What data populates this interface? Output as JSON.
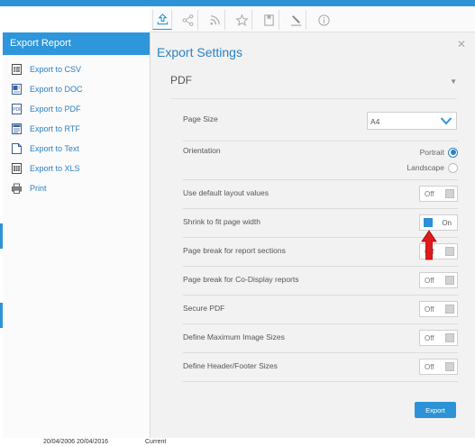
{
  "toolbar": {
    "icons": [
      "export-icon",
      "share-icon",
      "rss-icon",
      "star-icon",
      "bookmark-icon",
      "brush-icon",
      "info-icon"
    ]
  },
  "menu": {
    "title": "Export Report",
    "items": [
      {
        "label": "Export to CSV",
        "icon": "csv-file-icon"
      },
      {
        "label": "Export to DOC",
        "icon": "doc-file-icon"
      },
      {
        "label": "Export to PDF",
        "icon": "pdf-file-icon"
      },
      {
        "label": "Export to RTF",
        "icon": "rtf-file-icon"
      },
      {
        "label": "Export to Text",
        "icon": "text-file-icon"
      },
      {
        "label": "Export to XLS",
        "icon": "xls-file-icon"
      },
      {
        "label": "Print",
        "icon": "printer-icon"
      }
    ]
  },
  "panel": {
    "title": "Export Settings",
    "format": "PDF",
    "page_size": {
      "label": "Page Size",
      "value": "A4"
    },
    "orientation": {
      "label": "Orientation",
      "options": [
        "Portrait",
        "Landscape"
      ],
      "selected": "Portrait"
    },
    "toggles": [
      {
        "label": "Use default layout values",
        "value": "Off"
      },
      {
        "label": "Shrink to fit page width",
        "value": "On"
      },
      {
        "label": "Page break for report sections",
        "value": "Off"
      },
      {
        "label": "Page break for Co-Display reports",
        "value": "Off"
      },
      {
        "label": "Secure PDF",
        "value": "Off"
      },
      {
        "label": "Define Maximum Image Sizes",
        "value": "Off"
      },
      {
        "label": "Define Header/Footer Sizes",
        "value": "Off"
      }
    ],
    "export_label": "Export"
  },
  "footer": {
    "dates": "20/04/2006 20/04/2016",
    "status": "Current"
  },
  "colors": {
    "accent": "#2d93d6",
    "panel_bg": "#f2f2f2",
    "link": "#2b7fc1",
    "annotation_arrow": "#e01b1b"
  }
}
